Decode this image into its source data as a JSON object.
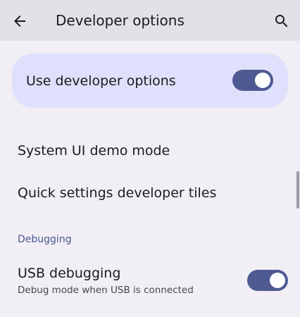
{
  "app_bar": {
    "title": "Developer options",
    "back_icon": "arrow-back-icon",
    "search_icon": "search-icon"
  },
  "master_toggle": {
    "label": "Use developer options",
    "checked": true
  },
  "items": [
    {
      "title": "System UI demo mode"
    },
    {
      "title": "Quick settings developer tiles"
    }
  ],
  "sections": [
    {
      "header": "Debugging",
      "items": [
        {
          "title": "USB debugging",
          "subtitle": "Debug mode when USB is connected",
          "checked": true
        }
      ]
    }
  ],
  "colors": {
    "app_bar_bg": "#e3e1e7",
    "page_bg": "#f1eff5",
    "master_card_bg": "#dfe0fb",
    "switch_track_on": "#4f5a93",
    "section_header": "#4c5890"
  }
}
